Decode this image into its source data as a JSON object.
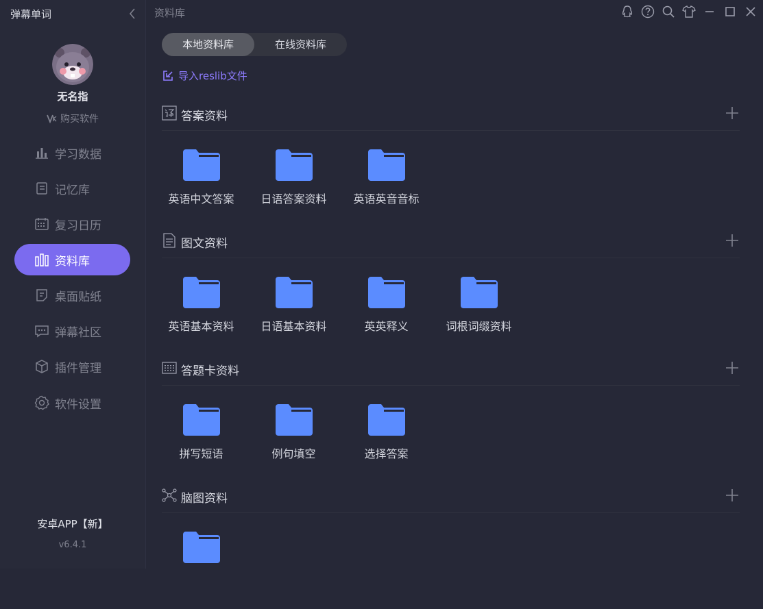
{
  "app": {
    "title": "弹幕单词"
  },
  "user": {
    "name": "无名指",
    "buy_label": "购买软件"
  },
  "nav": [
    {
      "id": "stats",
      "label": "学习数据",
      "icon": "bar-chart-icon",
      "active": false
    },
    {
      "id": "memory",
      "label": "记忆库",
      "icon": "notebook-icon",
      "active": false
    },
    {
      "id": "calendar",
      "label": "复习日历",
      "icon": "calendar-icon",
      "active": false
    },
    {
      "id": "library",
      "label": "资料库",
      "icon": "books-icon",
      "active": true
    },
    {
      "id": "sticker",
      "label": "桌面贴纸",
      "icon": "sticky-note-icon",
      "active": false
    },
    {
      "id": "community",
      "label": "弹幕社区",
      "icon": "chat-bubble-icon",
      "active": false
    },
    {
      "id": "plugins",
      "label": "插件管理",
      "icon": "cube-icon",
      "active": false
    },
    {
      "id": "settings",
      "label": "软件设置",
      "icon": "gear-icon",
      "active": false
    }
  ],
  "footer": {
    "android": "安卓APP【新】",
    "version": "v6.4.1"
  },
  "header": {
    "title": "资料库"
  },
  "tabs": [
    {
      "label": "本地资料库",
      "active": true
    },
    {
      "label": "在线资料库",
      "active": false
    }
  ],
  "import_label": "导入reslib文件",
  "sections": [
    {
      "title": "答案资料",
      "icon": "translate-icon",
      "folders": [
        "英语中文答案",
        "日语答案资料",
        "英语英音音标"
      ]
    },
    {
      "title": "图文资料",
      "icon": "document-icon",
      "folders": [
        "英语基本资料",
        "日语基本资料",
        "英英释义",
        "词根词缀资料"
      ]
    },
    {
      "title": "答题卡资料",
      "icon": "grid-card-icon",
      "folders": [
        "拼写短语",
        "例句填空",
        "选择答案"
      ]
    },
    {
      "title": "脑图资料",
      "icon": "mindmap-icon",
      "folders": [
        ""
      ]
    }
  ],
  "colors": {
    "accent": "#7b6bef",
    "folder": "#5b8cff",
    "link": "#8e7cff",
    "bg": "#262837"
  }
}
